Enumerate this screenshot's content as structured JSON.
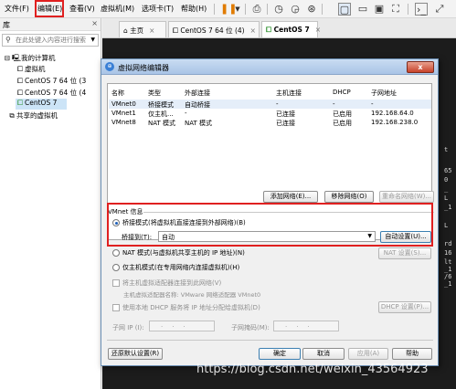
{
  "menu": {
    "items": [
      "文件(F)",
      "编辑(E)",
      "查看(V)",
      "虚拟机(M)",
      "选项卡(T)",
      "帮助(H)"
    ]
  },
  "toolbar": {
    "icons": [
      "pause-icon",
      "dropdown-icon",
      "send-keys-icon",
      "snapshot-icon",
      "revert-snapshot-icon",
      "manage-snapshots-icon",
      "console-view-icon",
      "single-window-icon",
      "split-view-icon",
      "fullscreen-icon",
      "unity-icon",
      "terminal-icon",
      "fit-window-icon"
    ]
  },
  "library": {
    "title": "库",
    "close": "×",
    "search_placeholder": "在此处键入内容进行搜索",
    "tree": [
      "我的计算机",
      "虚拟机",
      "CentOS 7 64 位 (3",
      "CentOS 7 64 位 (4",
      "CentOS 7",
      "共享的虚拟机"
    ]
  },
  "tabs": [
    {
      "label": "主页",
      "close": "×"
    },
    {
      "label": "CentOS 7 64 位 (4)",
      "close": "×"
    },
    {
      "label": "CentOS 7",
      "close": "×"
    }
  ],
  "terminal": [
    "t",
    "65",
    "0",
    "_",
    "L",
    "_1",
    "L",
    "rd",
    "16",
    "lt",
    "_1",
    "/6",
    "_1"
  ],
  "dialog": {
    "title": "虚拟网络编辑器",
    "close": "x",
    "table": {
      "headers": [
        "名称",
        "类型",
        "外部连接",
        "主机连接",
        "DHCP",
        "子网地址"
      ],
      "rows": [
        [
          "VMnet0",
          "桥接模式",
          "自动桥接",
          "-",
          "-",
          "-"
        ],
        [
          "VMnet1",
          "仅主机...",
          "-",
          "已连接",
          "已启用",
          "192.168.64.0"
        ],
        [
          "VMnet8",
          "NAT 模式",
          "NAT 模式",
          "已连接",
          "已启用",
          "192.168.238.0"
        ]
      ]
    },
    "add_network": "添加网络(E)...",
    "remove_network": "移除网络(O)",
    "rename_network": "重命名网络(W)...",
    "vmnet_info": "VMnet 信息",
    "bridged_mode": "桥接模式(将虚拟机直接连接到外部网络)(B)",
    "bridged_to_label": "桥接到(T):",
    "bridged_to_value": "自动",
    "auto_settings": "自动设置(U)...",
    "nat_mode": "NAT 模式(与虚拟机共享主机的 IP 地址)(N)",
    "nat_settings": "NAT 设置(S)...",
    "host_only": "仅主机模式(在专用网络内连接虚拟机)(H)",
    "connect_adapter": "将主机虚拟适配器连接到此网络(V)",
    "adapter_name": "主机虚拟适配器名称: VMware 网络适配器 VMnet0",
    "use_dhcp": "使用本地 DHCP 服务将 IP 地址分配给虚拟机(D)",
    "dhcp_settings": "DHCP 设置(P)...",
    "subnet_ip": "子网 IP (I):",
    "subnet_mask": "子网掩码(M):",
    "ip_dots": "...",
    "restore_defaults": "还原默认设置(R)",
    "ok": "确定",
    "cancel": "取消",
    "apply": "应用(A)",
    "help": "帮助"
  },
  "watermark": "https://blog.csdn.net/weixin_43564923"
}
